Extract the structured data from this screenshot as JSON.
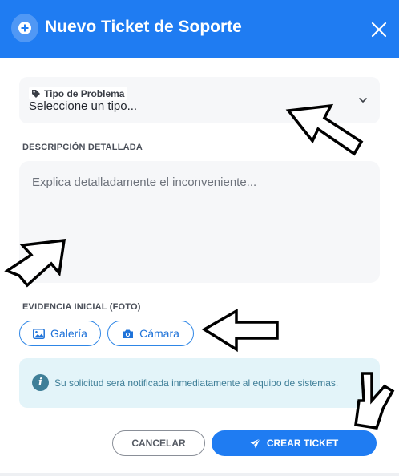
{
  "header": {
    "title": "Nuevo Ticket de Soporte",
    "icon": "plus-circle-icon",
    "close_icon": "close-icon",
    "color": "#1f7cf2"
  },
  "problem_type": {
    "label": "Tipo de Problema",
    "label_icon": "tag-icon",
    "placeholder": "Seleccione un tipo...",
    "chevron_icon": "chevron-down-icon"
  },
  "description": {
    "label": "DESCRIPCIÓN DETALLADA",
    "placeholder": "Explica detalladamente el inconveniente..."
  },
  "evidence": {
    "label": "EVIDENCIA INICIAL (FOTO)",
    "gallery_label": "Galería",
    "gallery_icon": "image-icon",
    "camera_label": "Cámara",
    "camera_icon": "camera-icon"
  },
  "info": {
    "icon": "info-icon",
    "text": "Su solicitud será notificada inmediatamente al equipo de sistemas."
  },
  "actions": {
    "cancel_label": "CANCELAR",
    "create_label": "CREAR TICKET",
    "create_icon": "send-icon"
  },
  "colors": {
    "primary": "#1f7cf2",
    "info_bg": "#e3f4f9",
    "info_text": "#3f7f98"
  }
}
